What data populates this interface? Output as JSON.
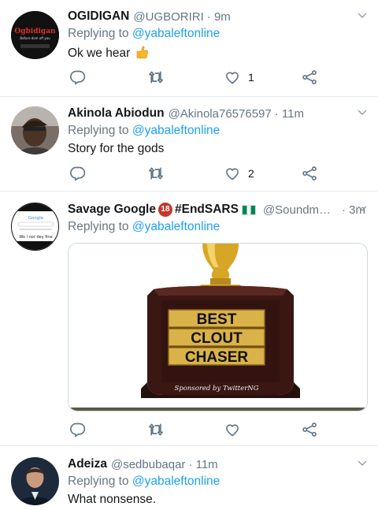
{
  "tweets": [
    {
      "name": "OGIDIGAN",
      "handle": "@UGBORIRI",
      "time": "· 9m",
      "replying_prefix": "Replying to ",
      "replying_to": "@yabaleftonline",
      "text": "Ok we hear",
      "likes": "1",
      "avatar_text": "Ogbidigan",
      "avatar_subtext": "Before dem off you"
    },
    {
      "name": "Akinola Abiodun",
      "handle": "@Akinola76576597",
      "time": "· 11m",
      "replying_prefix": "Replying to ",
      "replying_to": "@yabaleftonline",
      "text": "Story for the gods",
      "likes": "2"
    },
    {
      "name": "Savage Google",
      "badge": "18",
      "hashtag": "#EndSARS",
      "handle": "@Soundma...",
      "time": "· 3m",
      "replying_prefix": "Replying to ",
      "replying_to": "@yabaleftonline",
      "avatar_text": "Google",
      "avatar_caption": "Wo l nor dey fine",
      "image": {
        "line1": "BEST",
        "line2": "CLOUT",
        "line3": "CHASER",
        "signature": "Sponsored by TwitterNG"
      }
    },
    {
      "name": "Adeiza",
      "handle": "@sedbubaqar",
      "time": "· 11m",
      "replying_prefix": "Replying to ",
      "replying_to": "@yabaleftonline",
      "text": "What nonsense."
    }
  ],
  "colors": {
    "link_blue": "#1da1f2",
    "secondary_gray": "#657786",
    "divider": "#e6ecf0"
  },
  "icons": [
    "reply-icon",
    "retweet-icon",
    "like-icon",
    "share-icon",
    "chevron-down-icon"
  ]
}
